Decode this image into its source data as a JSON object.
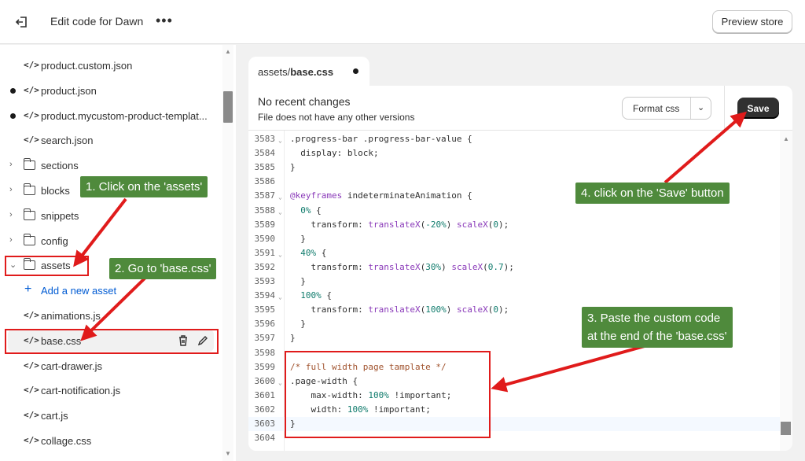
{
  "topbar": {
    "exit_icon": "exit-icon",
    "title": "Edit code for Dawn",
    "more_icon": "more-horizontal-icon",
    "more_glyph": "•••",
    "preview_label": "Preview store"
  },
  "sidebar": {
    "files_top": [
      {
        "label": "product.custom.json",
        "modified": false
      },
      {
        "label": "product.json",
        "modified": true
      },
      {
        "label": "product.mycustom-product-templat...",
        "modified": true
      },
      {
        "label": "search.json",
        "modified": false
      }
    ],
    "folders": [
      {
        "label": "sections",
        "expanded": false
      },
      {
        "label": "blocks",
        "expanded": false
      },
      {
        "label": "snippets",
        "expanded": false
      },
      {
        "label": "config",
        "expanded": false
      },
      {
        "label": "assets",
        "expanded": true
      }
    ],
    "add_asset_label": "Add a new asset",
    "asset_files": [
      {
        "label": "animations.js"
      },
      {
        "label": "base.css",
        "selected": true
      },
      {
        "label": "cart-drawer.js"
      },
      {
        "label": "cart-notification.js"
      },
      {
        "label": "cart.js"
      },
      {
        "label": "collage.css"
      }
    ]
  },
  "editor": {
    "tab": {
      "path_prefix": "assets/",
      "filename": "base.css",
      "unsaved": true
    },
    "changes_title": "No recent changes",
    "changes_subtitle": "File does not have any other versions",
    "format_label": "Format css",
    "save_label": "Save",
    "lines": [
      {
        "n": "3583",
        "fold": true,
        "text": ".progress-bar .progress-bar-value {"
      },
      {
        "n": "3584",
        "fold": false,
        "text": "  display: block;"
      },
      {
        "n": "3585",
        "fold": false,
        "text": "}"
      },
      {
        "n": "3586",
        "fold": false,
        "text": ""
      },
      {
        "n": "3587",
        "fold": true,
        "text": "@keyframes indeterminateAnimation {"
      },
      {
        "n": "3588",
        "fold": true,
        "text": "  0% {"
      },
      {
        "n": "3589",
        "fold": false,
        "text": "    transform: translateX(-20%) scaleX(0);"
      },
      {
        "n": "3590",
        "fold": false,
        "text": "  }"
      },
      {
        "n": "3591",
        "fold": true,
        "text": "  40% {"
      },
      {
        "n": "3592",
        "fold": false,
        "text": "    transform: translateX(30%) scaleX(0.7);"
      },
      {
        "n": "3593",
        "fold": false,
        "text": "  }"
      },
      {
        "n": "3594",
        "fold": true,
        "text": "  100% {"
      },
      {
        "n": "3595",
        "fold": false,
        "text": "    transform: translateX(100%) scaleX(0);"
      },
      {
        "n": "3596",
        "fold": false,
        "text": "  }"
      },
      {
        "n": "3597",
        "fold": false,
        "text": "}"
      },
      {
        "n": "3598",
        "fold": false,
        "text": ""
      },
      {
        "n": "3599",
        "fold": false,
        "text": "/* full width page tamplate */"
      },
      {
        "n": "3600",
        "fold": true,
        "text": ".page-width {"
      },
      {
        "n": "3601",
        "fold": false,
        "text": "    max-width: 100% !important;"
      },
      {
        "n": "3602",
        "fold": false,
        "text": "    width: 100% !important;"
      },
      {
        "n": "3603",
        "fold": false,
        "text": "}",
        "active": true
      },
      {
        "n": "3604",
        "fold": false,
        "text": ""
      }
    ]
  },
  "annotations": {
    "step1": "1. Click on the 'assets'",
    "step2": "2. Go to 'base.css'",
    "step3_line1": "3. Paste the custom code",
    "step3_line2": "at the end of the 'base.css'",
    "step4": "4. click on the 'Save' button"
  },
  "colors": {
    "callout_bg": "#4f8a3c",
    "highlight_red": "#e01b1b",
    "save_bg": "#303030",
    "link_blue": "#005bd3"
  }
}
